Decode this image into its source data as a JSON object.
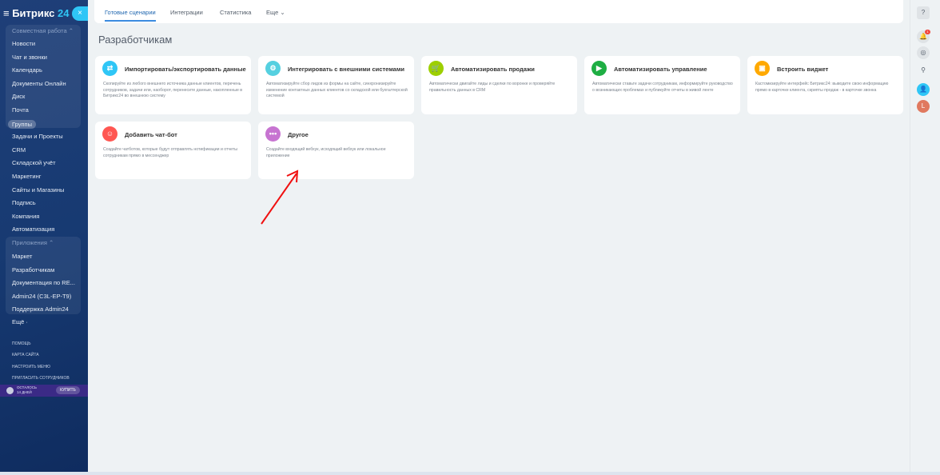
{
  "sidebar": {
    "logo": "Битрикс",
    "logo_num": "24",
    "close": "×",
    "groups": {
      "collab": "Совместная работа ⌃",
      "apps": "Приложения ⌃"
    },
    "items": [
      "Новости",
      "Чат и звонки",
      "Календарь",
      "Документы Онлайн",
      "Диск",
      "Почта",
      "Группы",
      "Задачи и Проекты",
      "CRM",
      "Складской учёт",
      "Маркетинг",
      "Сайты и Магазины",
      "Подпись",
      "Компания",
      "Автоматизация"
    ],
    "app_items": [
      "Маркет",
      "Разработчикам",
      "Документация по RE...",
      "Admin24 (C3L-EP-T9)",
      "Поддержка Admin24"
    ],
    "more": "Ещё ·",
    "links": [
      "помощь",
      "карта сайта",
      "настроить меню",
      "пригласить сотрудников"
    ],
    "trial": {
      "line1": "осталось",
      "line2": "14 дней",
      "buy": "купить"
    }
  },
  "tabs": [
    "Готовые сценарии",
    "Интеграции",
    "Статистика",
    "Еще ⌄"
  ],
  "page_title": "Разработчикам",
  "cards": [
    {
      "title": "Импортировать/экспортировать данные",
      "desc": "Скопируйте из любого внешнего источника данные клиентов, перечень сотрудников, задачи или, наоборот, перенесите данные, накопленные в Битрикс24 во внешнюю систему",
      "icon": "⇄",
      "color": "#2fc6f6"
    },
    {
      "title": "Интегрировать с внешними системами",
      "desc": "Автоматизируйте сбор лидов из формы на сайте, синхронизируйте изменение контактных данных клиентов со складской или бухгалтерской системой",
      "icon": "⚙",
      "color": "#55d0e0"
    },
    {
      "title": "Автоматизировать продажи",
      "desc": "Автоматически двигайте лиды и сделки по воронке и проверяйте правильность данных в CRM",
      "icon": "🛒",
      "color": "#9dcf00"
    },
    {
      "title": "Автоматизировать управление",
      "desc": "Автоматически ставьте задачи сотрудникам, информируйте руководство о возникающих проблемах и публикуйте отчеты в живой ленте",
      "icon": "▶",
      "color": "#1eae43"
    },
    {
      "title": "Встроить виджет",
      "desc": "Кастомизируйте интерфейс Битрикс24: выводите свою информацию прямо в карточке клиента, скрипты продаж - в карточке звонка",
      "icon": "▣",
      "color": "#ffa900"
    },
    {
      "title": "Добавить чат-бот",
      "desc": "Создайте чатботов, которые будут отправлять нотификации и отчеты сотрудникам прямо в мессенджер",
      "icon": "☺",
      "color": "#ff5752"
    },
    {
      "title": "Другое",
      "desc": "Создайте входящий вебхук, исходящий вебхук или локальное приложение",
      "icon": "•••",
      "color": "#c774d1"
    }
  ],
  "rightbar": {
    "help": "?",
    "notif_count": "1",
    "avatar": "L"
  }
}
